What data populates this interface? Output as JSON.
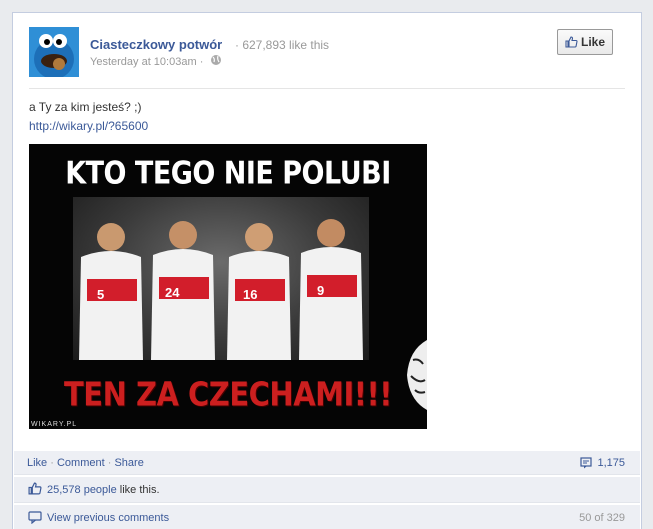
{
  "post": {
    "page_name": "Ciasteczkowy potwór",
    "likes_count": "· 627,893 like this",
    "timestamp": "Yesterday at 10:03am",
    "timestamp_sep": "·",
    "like_button_label": "Like",
    "text": "a Ty za kim jesteś? ;)",
    "link": "http://wikary.pl/?65600"
  },
  "image": {
    "top_text": "KTO TEGO NIE POLUBI",
    "bottom_text": "TEN ZA CZECHAMI!!!",
    "watermark": "WIKARY.PL",
    "jersey_numbers": [
      "5",
      "24",
      "16",
      "9"
    ]
  },
  "actions": {
    "like": "Like",
    "comment": "Comment",
    "share": "Share",
    "separator": "·",
    "comment_count": "1,175"
  },
  "likes": {
    "people": "25,578 people",
    "suffix": "like this."
  },
  "comments": {
    "view_previous": "View previous comments",
    "pager": "50 of 329"
  },
  "colors": {
    "link": "#3b5998",
    "bar_bg": "#edeff4",
    "image_red": "#cc1f1f"
  },
  "icons": {
    "avatar": "cookie-monster-avatar",
    "globe": "globe-icon",
    "like": "thumbs-up-icon",
    "comment": "comment-icon",
    "bubble": "speech-bubble-icon"
  }
}
